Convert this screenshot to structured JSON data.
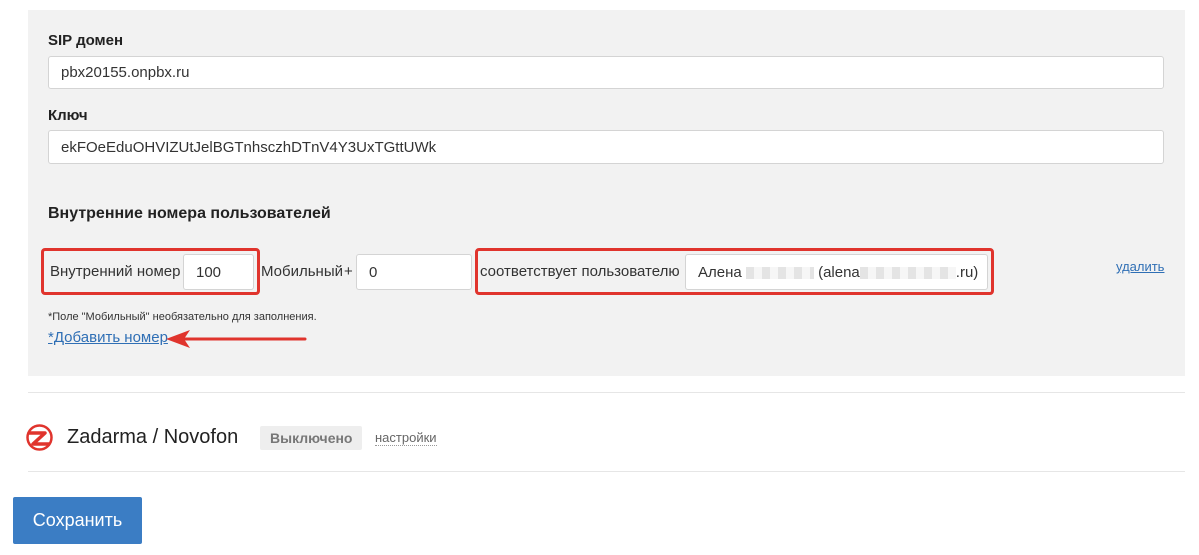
{
  "sip": {
    "domain_label": "SIP домен",
    "domain_value": "pbx20155.onpbx.ru",
    "key_label": "Ключ",
    "key_value": "ekFOeEduOHVIZUtJelBGTnhsczhDTnV4Y3UxTGttUWk"
  },
  "users": {
    "section_title": "Внутренние номера пользователей",
    "row": {
      "internal_label": "Внутренний номер",
      "internal_value": "100",
      "mobile_label": "Мобильный",
      "mobile_plus": "+",
      "mobile_value": "0",
      "matches_label": "соответствует пользователю",
      "user_name_start": "Алена",
      "user_email_start": "(alena",
      "user_email_end": ".ru)",
      "delete_label": "удалить"
    },
    "note": "*Поле \"Мобильный\" необязательно для заполнения.",
    "add_label": "*Добавить номер"
  },
  "provider": {
    "icon": "zadarma-logo-icon",
    "name": "Zadarma / Novofon",
    "status": "Выключено",
    "settings_label": "настройки"
  },
  "save_label": "Сохранить",
  "colors": {
    "highlight": "#e0342d",
    "link": "#2f6fb5",
    "primary_button": "#3b7dc4",
    "panel_bg": "#f2f2f2"
  }
}
